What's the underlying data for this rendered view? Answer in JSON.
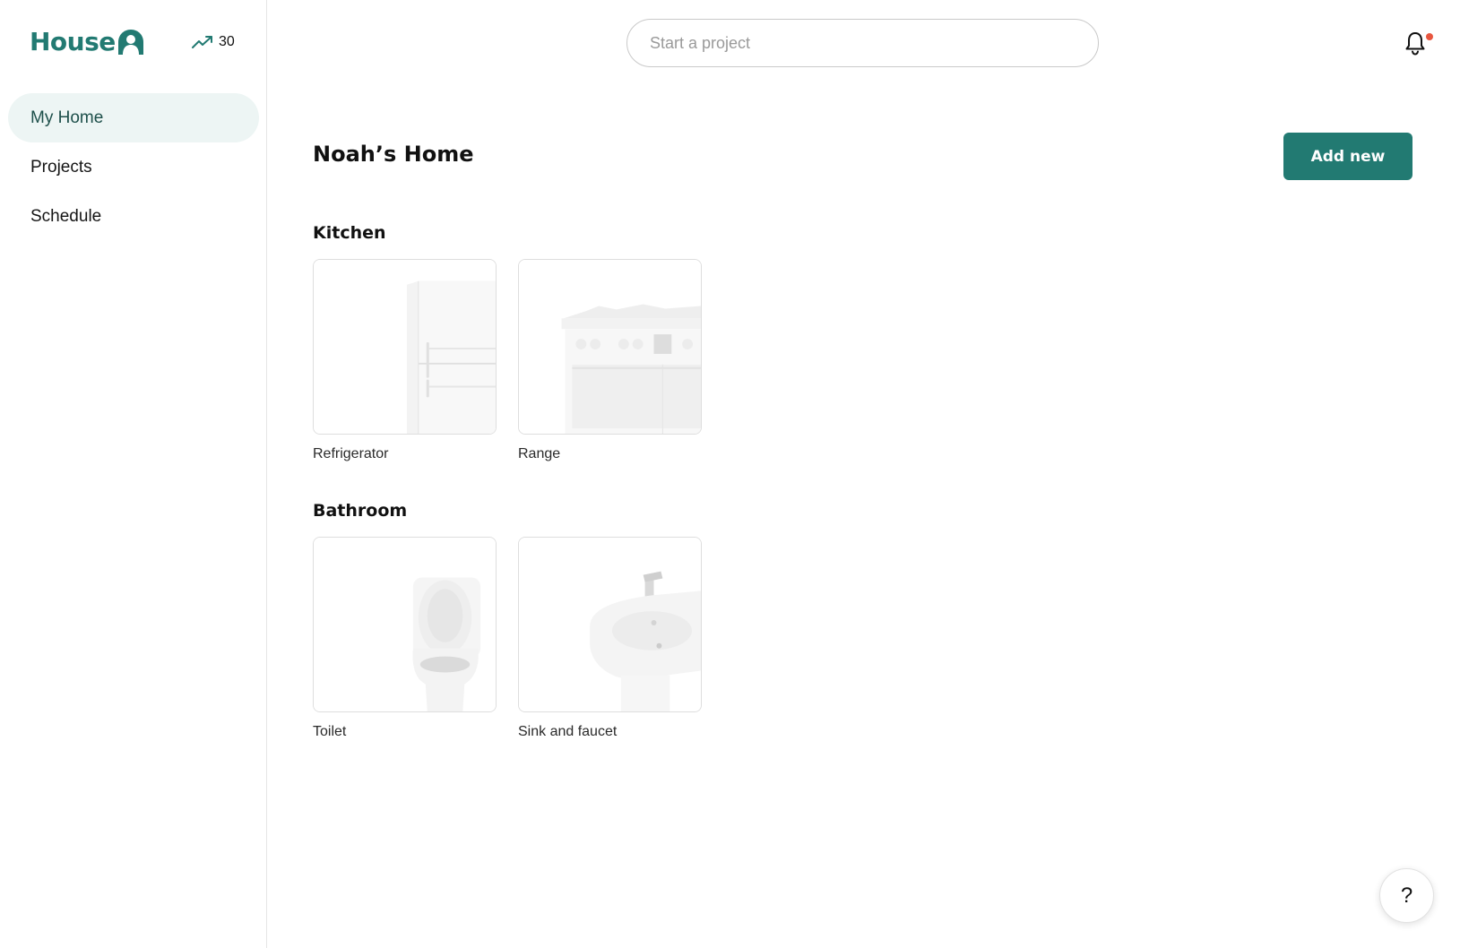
{
  "brand": {
    "name": "House",
    "logo_icon": "house-person-icon",
    "accent": "#227a72"
  },
  "score": {
    "icon": "trending-up-icon",
    "value": "30"
  },
  "sidebar": {
    "items": [
      {
        "label": "My Home",
        "active": true
      },
      {
        "label": "Projects",
        "active": false
      },
      {
        "label": "Schedule",
        "active": false
      }
    ]
  },
  "header": {
    "search_placeholder": "Start a project",
    "bell_icon": "bell-icon",
    "notification_dot_color": "#e8563f"
  },
  "main": {
    "title": "Noah’s Home",
    "add_button": "Add new",
    "sections": [
      {
        "title": "Kitchen",
        "items": [
          {
            "label": "Refrigerator",
            "image": "refrigerator"
          },
          {
            "label": "Range",
            "image": "range"
          }
        ]
      },
      {
        "title": "Bathroom",
        "items": [
          {
            "label": "Toilet",
            "image": "toilet"
          },
          {
            "label": "Sink and faucet",
            "image": "sink"
          }
        ]
      }
    ]
  },
  "help": {
    "label": "?"
  }
}
